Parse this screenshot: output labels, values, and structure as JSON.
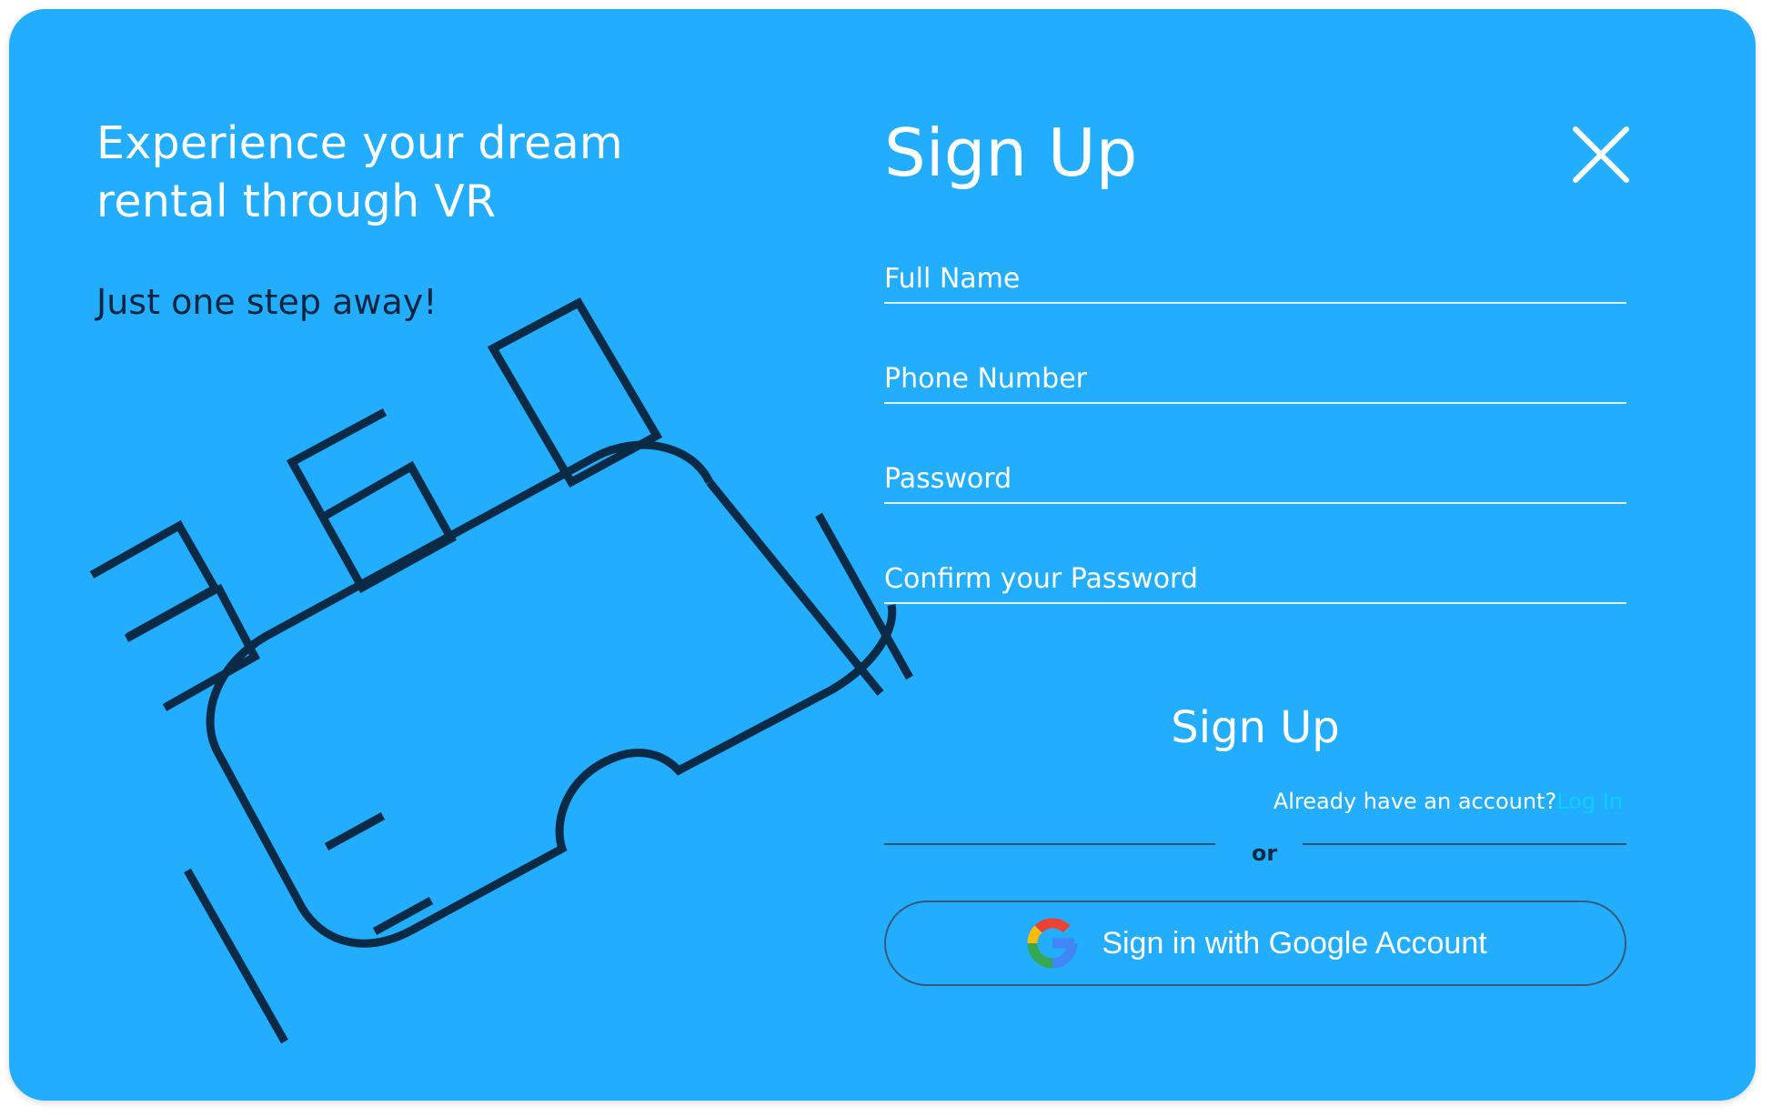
{
  "colors": {
    "background": "#23adff",
    "text_primary": "#ffffff",
    "text_dark": "#0b2440",
    "link": "#0ad0ff",
    "illustration_stroke": "#0b2a45"
  },
  "hero": {
    "headline_line1": "Experience your dream",
    "headline_line2": "rental through VR",
    "tagline": "Just one step away!",
    "illustration_icon": "vr-headset-360-icon"
  },
  "form": {
    "title": "Sign Up",
    "close_icon": "close-icon",
    "fields": {
      "full_name": {
        "placeholder": "Full Name",
        "value": ""
      },
      "phone": {
        "placeholder": "Phone Number",
        "value": ""
      },
      "password": {
        "placeholder": "Password",
        "value": ""
      },
      "confirm_password": {
        "placeholder": "Confirm your Password",
        "value": ""
      }
    },
    "submit_label": "Sign Up",
    "login_prompt": "Already have an account?",
    "login_link": "Log In",
    "divider_text": "or",
    "google_button_label": "Sign in with Google Account",
    "google_icon": "google-logo-icon"
  }
}
